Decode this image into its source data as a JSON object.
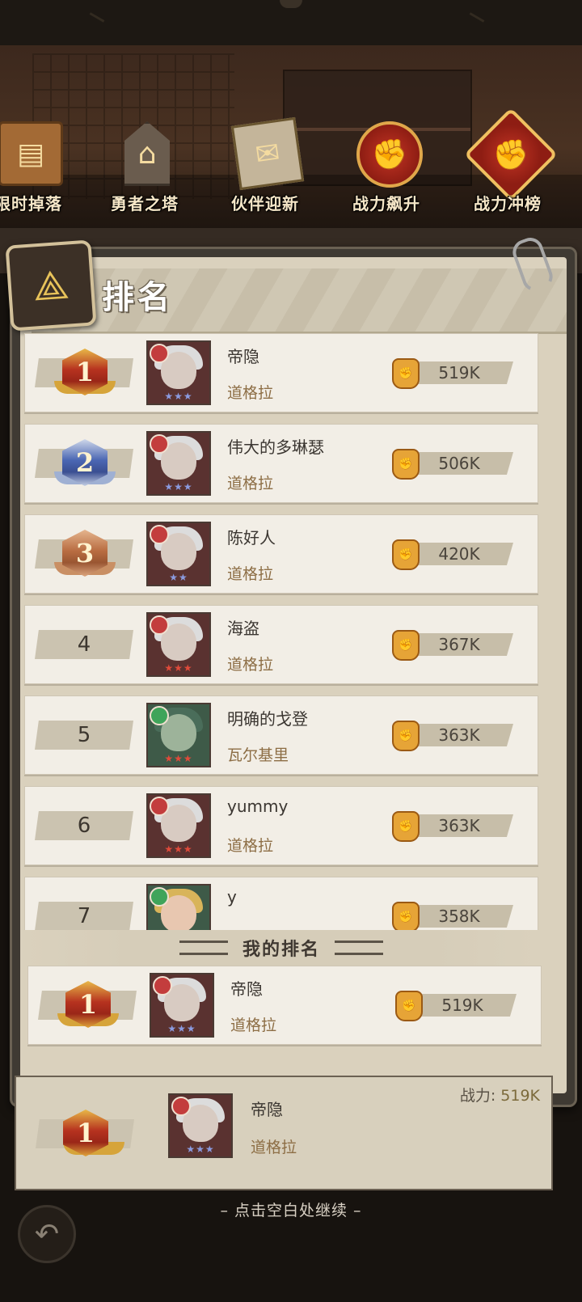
{
  "top_nav": [
    {
      "label": "限时掉落",
      "icon": "treasure-box-icon"
    },
    {
      "label": "勇者之塔",
      "icon": "tower-icon"
    },
    {
      "label": "伙伴迎新",
      "icon": "book-icon"
    },
    {
      "label": "战力飙升",
      "icon": "fist-icon"
    },
    {
      "label": "战力冲榜",
      "icon": "fist-crest-icon"
    }
  ],
  "panel": {
    "title": "排名"
  },
  "ranking": [
    {
      "rank": "1",
      "medal": "gold",
      "name": "帝隐",
      "hero": "道格拉",
      "power": "519K",
      "stars": "★★★",
      "star_color": "#8b9be0",
      "avatar_type": "red"
    },
    {
      "rank": "2",
      "medal": "silver",
      "name": "伟大的多琳瑟",
      "hero": "道格拉",
      "power": "506K",
      "stars": "★★★",
      "star_color": "#8b9be0",
      "avatar_type": "red"
    },
    {
      "rank": "3",
      "medal": "bronze",
      "name": "陈好人",
      "hero": "道格拉",
      "power": "420K",
      "stars": "★★",
      "star_color": "#8b9be0",
      "avatar_type": "red"
    },
    {
      "rank": "4",
      "medal": "",
      "name": "海盗",
      "hero": "道格拉",
      "power": "367K",
      "stars": "★★★",
      "star_color": "#e04a3a",
      "avatar_type": "red"
    },
    {
      "rank": "5",
      "medal": "",
      "name": "明确的戈登",
      "hero": "瓦尔基里",
      "power": "363K",
      "stars": "★★★",
      "star_color": "#e04a3a",
      "avatar_type": "green"
    },
    {
      "rank": "6",
      "medal": "",
      "name": "yummy",
      "hero": "道格拉",
      "power": "363K",
      "stars": "★★★",
      "star_color": "#e04a3a",
      "avatar_type": "red"
    },
    {
      "rank": "7",
      "medal": "",
      "name": "y",
      "hero": "",
      "power": "358K",
      "stars": "",
      "star_color": "#e04a3a",
      "avatar_type": "green"
    }
  ],
  "my_rank": {
    "header": "我的排名",
    "rank": "1",
    "medal": "gold",
    "name": "帝隐",
    "hero": "道格拉",
    "power": "519K",
    "stars": "★★★",
    "star_color": "#8b9be0"
  },
  "bottom_card": {
    "power_label": "战力:",
    "power_value": "519K",
    "rank": "1",
    "name": "帝隐",
    "hero": "道格拉",
    "stars": "★★★"
  },
  "footer": {
    "continue_text": "–  点击空白处继续  –"
  }
}
